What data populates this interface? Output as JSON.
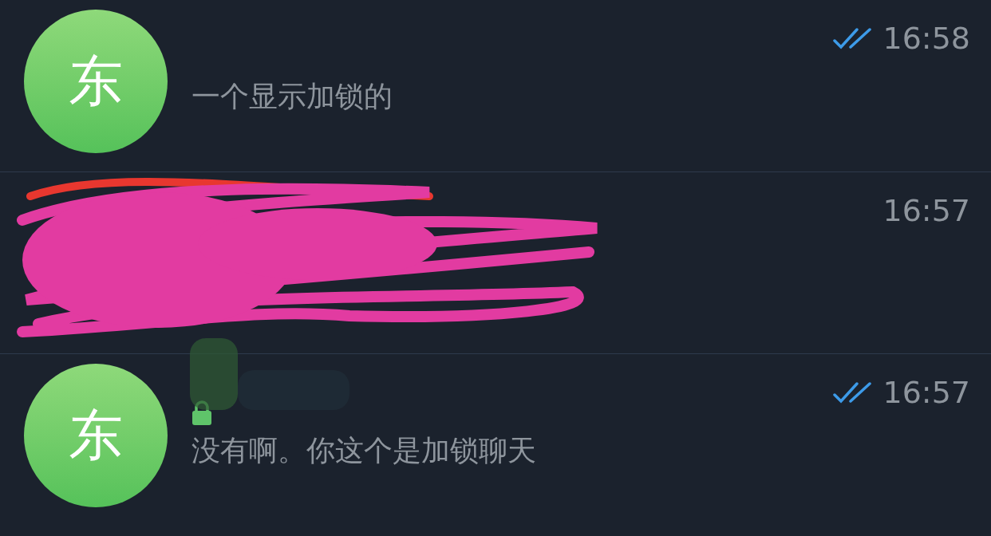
{
  "chats": [
    {
      "kind": "chat",
      "avatar": "东",
      "preview": "一个显示加锁的",
      "time": "16:58",
      "read": true,
      "locked": false
    },
    {
      "kind": "redacted",
      "time": "16:57",
      "read": false,
      "locked": false
    },
    {
      "kind": "chat",
      "avatar": "东",
      "preview": "没有啊。你这个是加锁聊天",
      "time": "16:57",
      "read": true,
      "locked": true
    }
  ]
}
